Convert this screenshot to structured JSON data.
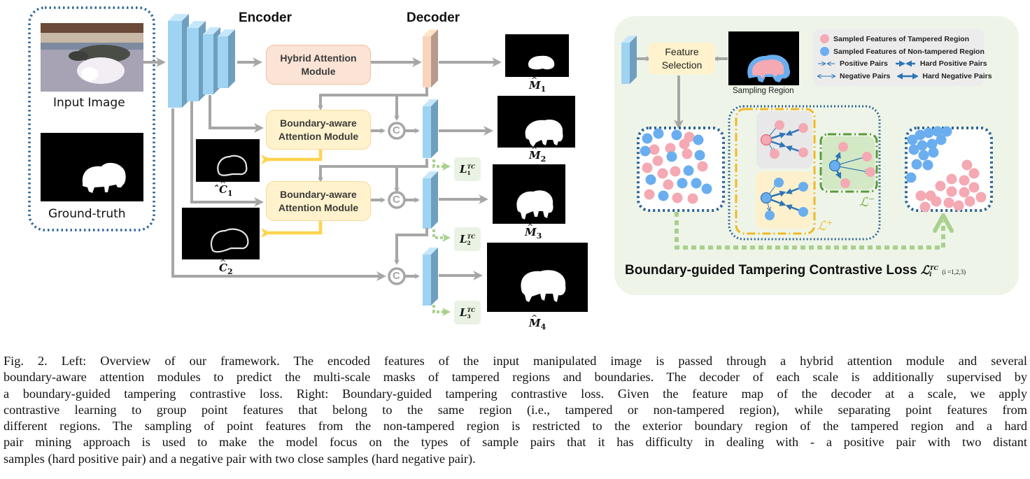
{
  "figure": {
    "left_panel": {
      "input_image_label": "Input Image",
      "ground_truth_label": "Ground-truth",
      "encoder_label": "Encoder",
      "decoder_label": "Decoder",
      "hybrid_module_label": "Hybrid Attention Module",
      "hybrid_module_lines": [
        "Hybrid Attention",
        "Module"
      ],
      "baam_lines": [
        "Boundary-aware",
        "Attention Module"
      ],
      "concat_symbol": "C",
      "boundary_outputs": [
        {
          "base": "C",
          "sub": "1"
        },
        {
          "base": "C",
          "sub": "2"
        }
      ],
      "mask_outputs": [
        {
          "base": "M",
          "sub": "1"
        },
        {
          "base": "M",
          "sub": "2"
        },
        {
          "base": "M",
          "sub": "3"
        },
        {
          "base": "M",
          "sub": "4"
        }
      ],
      "losses": [
        {
          "base": "L",
          "sup": "TC",
          "sub": "1"
        },
        {
          "base": "L",
          "sup": "TC",
          "sub": "2"
        },
        {
          "base": "L",
          "sup": "TC",
          "sub": "3"
        }
      ]
    },
    "right_panel": {
      "feature_selection_lines": [
        "Feature",
        "Selection"
      ],
      "sampling_region_label": "Sampling Region",
      "legend": [
        {
          "icon": "pink-dot",
          "label": "Sampled Features of Tampered Region"
        },
        {
          "icon": "blue-dot",
          "label": "Sampled Features of Non-tampered Region"
        },
        {
          "icon": "positive-pair-arrow",
          "label": "Positive Pairs"
        },
        {
          "icon": "hard-positive-pair-arrow",
          "label": "Hard Positive Pairs"
        },
        {
          "icon": "negative-pair-arrow",
          "label": "Negative Pairs"
        },
        {
          "icon": "hard-negative-pair-arrow",
          "label": "Hard Negative Pairs"
        }
      ],
      "loss_plus": "+",
      "loss_minus": "−",
      "bottom_title": "Boundary-guided Tampering Contrastive Loss",
      "bottom_math": {
        "base": "L",
        "sup": "TC",
        "sub": "i",
        "range": "(i =1,2,3)"
      }
    },
    "colors": {
      "encoder_blue": "#9fd3f2",
      "encoder_side": "#6f9fbf",
      "decoder_orange": "#f8d5bf",
      "hybrid_fill": "#fbe3d5",
      "baam_fill": "#fff2cc",
      "arrow_gray": "#a6a6a6",
      "arrow_yellow": "#ffd34d",
      "loss_green": "#a9d18e",
      "dotted_border": "#2e6496",
      "right_bg": "#eef5e8",
      "tampered_pink": "#f4a9b3",
      "non_tampered_blue": "#6aaef0"
    }
  },
  "caption": {
    "lines": [
      "Fig. 2.   Left: Overview of our framework. The encoded features of the input manipulated image is passed through a hybrid attention module and several",
      "boundary-aware attention modules to predict the multi-scale masks of tampered regions and boundaries. The decoder of each scale is additionally supervised by",
      "a boundary-guided tampering contrastive loss. Right: Boundary-guided tampering contrastive loss. Given the feature map of the decoder at a scale, we apply",
      "contrastive learning to group point features that belong to the same region (i.e., tampered or non-tampered region), while separating point features from",
      "different regions. The sampling of point features from the non-tampered region is restricted to the exterior boundary region of the tampered region and a hard",
      "pair mining approach is used to make the model focus on the types of sample pairs that it has difficulty in dealing with - a positive pair with two distant",
      "samples (hard positive pair) and a negative pair with two close samples (hard negative pair)."
    ]
  }
}
